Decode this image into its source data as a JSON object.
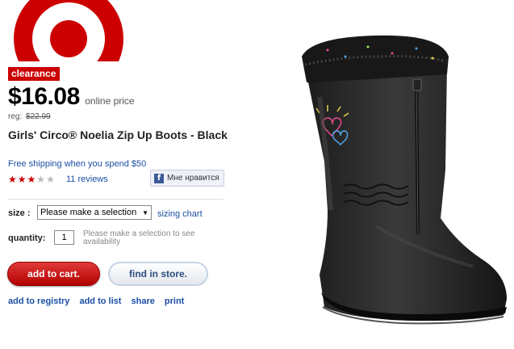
{
  "brand": {
    "registered_mark": "®",
    "accent_color": "#cc0000"
  },
  "badge": "clearance",
  "price": {
    "current": "$16.08",
    "note": "online price",
    "reg_label": "reg:",
    "reg_value": "$22.99"
  },
  "product": {
    "title": "Girls' Circo® Noelia Zip Up Boots - Black"
  },
  "shipping": "Free shipping when you spend $50",
  "rating": {
    "stars_filled": 3,
    "stars_total": 5,
    "reviews": "11 reviews"
  },
  "facebook": {
    "icon": "facebook-icon",
    "label": "Мне нравится"
  },
  "size": {
    "label": "size :",
    "selected": "Please make a selection",
    "chart_link": "sizing chart"
  },
  "quantity": {
    "label": "quantity:",
    "value": "1",
    "note": "Please make a selection to see availability"
  },
  "buttons": {
    "add_to_cart": "add to cart.",
    "find_in_store": "find in store."
  },
  "links": {
    "registry": "add to registry",
    "list": "add to list",
    "share": "share",
    "print": "print"
  }
}
